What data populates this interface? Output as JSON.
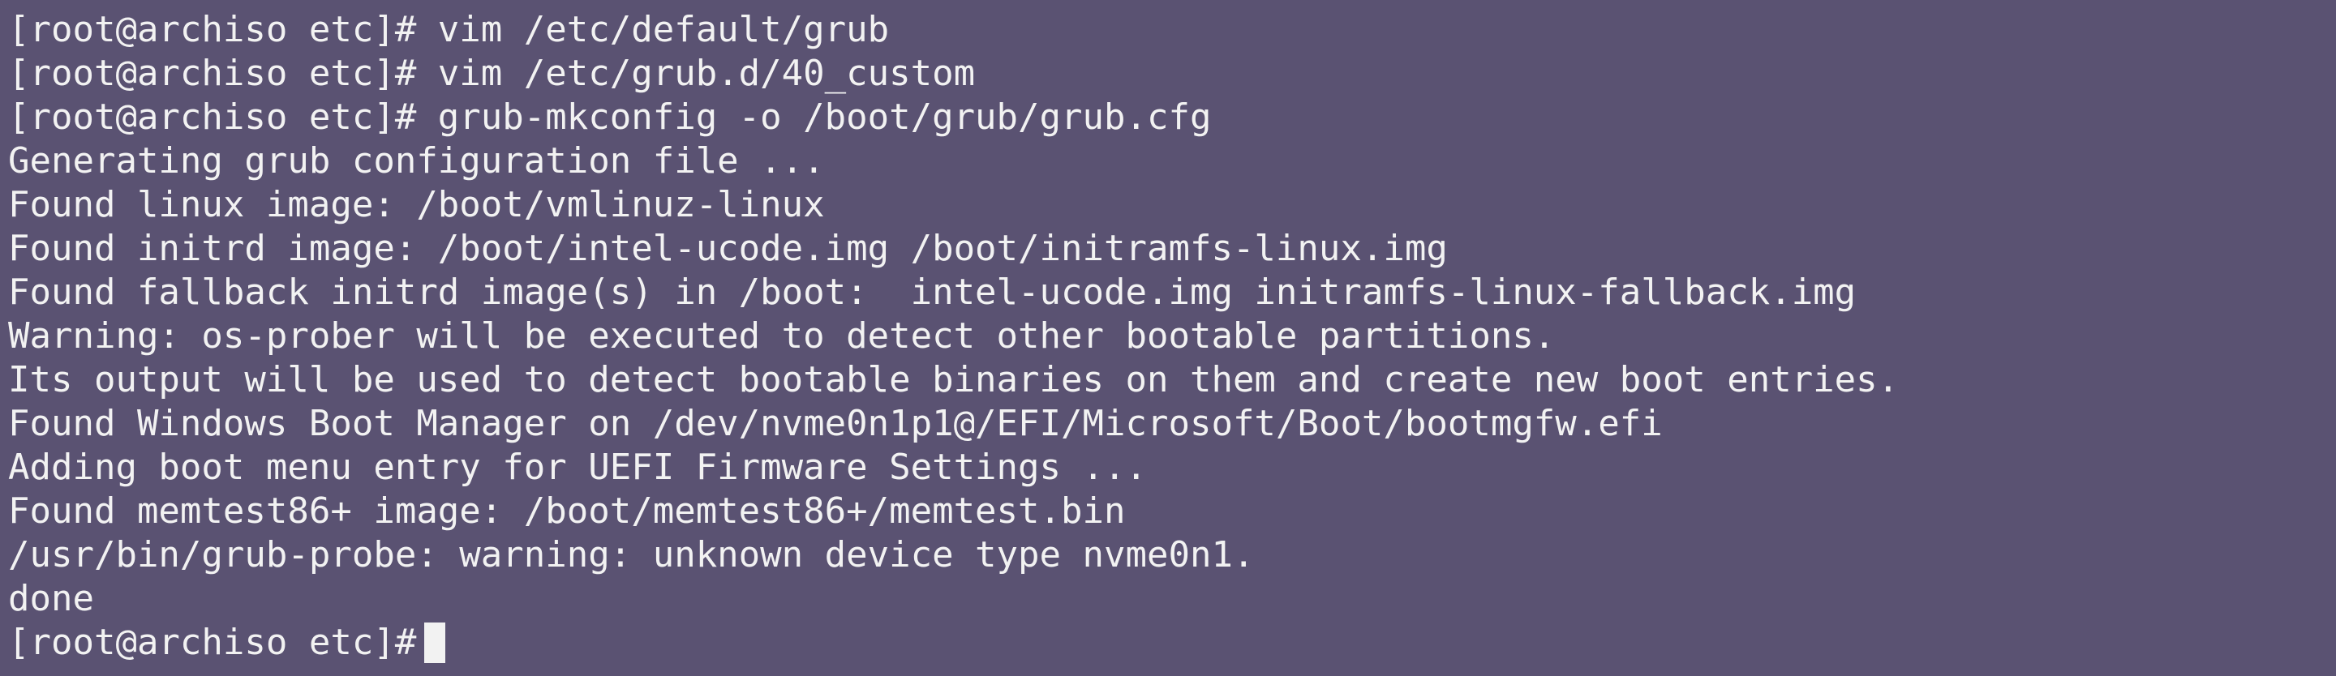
{
  "terminal": {
    "lines": [
      "[root@archiso etc]# vim /etc/default/grub",
      "[root@archiso etc]# vim /etc/grub.d/40_custom",
      "[root@archiso etc]# grub-mkconfig -o /boot/grub/grub.cfg",
      "Generating grub configuration file ...",
      "Found linux image: /boot/vmlinuz-linux",
      "Found initrd image: /boot/intel-ucode.img /boot/initramfs-linux.img",
      "Found fallback initrd image(s) in /boot:  intel-ucode.img initramfs-linux-fallback.img",
      "Warning: os-prober will be executed to detect other bootable partitions.",
      "Its output will be used to detect bootable binaries on them and create new boot entries.",
      "Found Windows Boot Manager on /dev/nvme0n1p1@/EFI/Microsoft/Boot/bootmgfw.efi",
      "Adding boot menu entry for UEFI Firmware Settings ...",
      "Found memtest86+ image: /boot/memtest86+/memtest.bin",
      "/usr/bin/grub-probe: warning: unknown device type nvme0n1.",
      "done"
    ],
    "prompt": "[root@archiso etc]#"
  }
}
